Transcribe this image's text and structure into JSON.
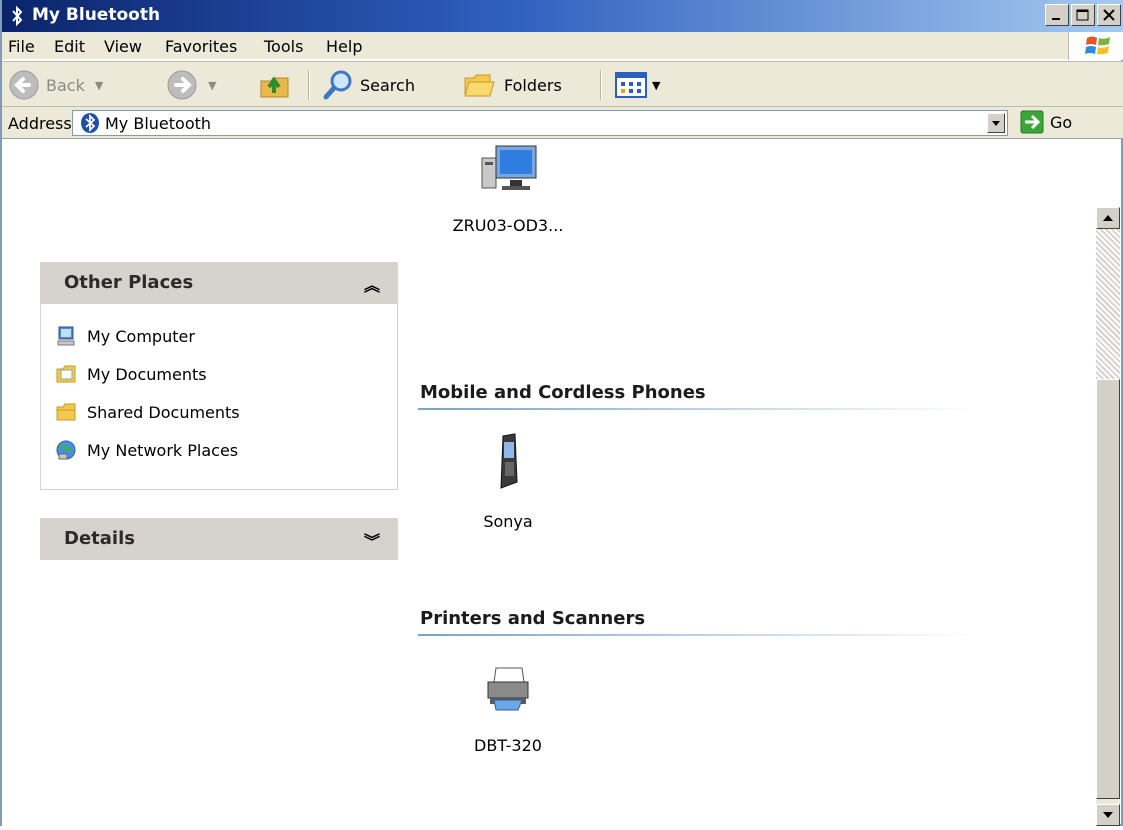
{
  "window": {
    "title": "My Bluetooth"
  },
  "menu": [
    "File",
    "Edit",
    "View",
    "Favorites",
    "Tools",
    "Help"
  ],
  "toolbar": {
    "back": "Back",
    "search": "Search",
    "folders": "Folders"
  },
  "address": {
    "label": "Address",
    "value": "My Bluetooth",
    "go": "Go"
  },
  "left_pane": {
    "other_places": {
      "title": "Other Places",
      "items": [
        "My Computer",
        "My Documents",
        "Shared Documents",
        "My Network Places"
      ]
    },
    "details": {
      "title": "Details"
    }
  },
  "content": {
    "computer_item": "ZRU03-OD3...",
    "groups": [
      {
        "title": "Mobile and Cordless Phones",
        "item": "Sonya"
      },
      {
        "title": "Printers and Scanners",
        "item": "DBT-320"
      }
    ]
  }
}
